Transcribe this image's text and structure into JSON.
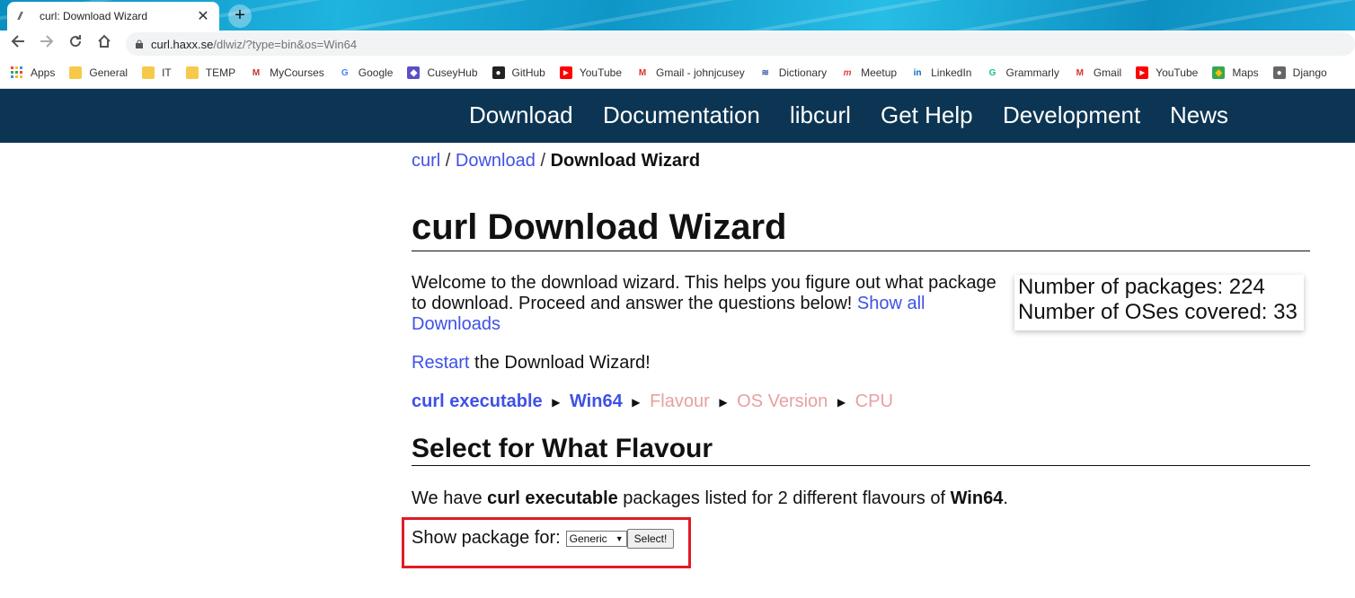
{
  "browser": {
    "tab_title": "curl: Download Wizard",
    "tab_close": "✕",
    "new_tab": "+",
    "url_host": "curl.haxx.se",
    "url_path": "/dlwiz/?type=bin&os=Win64",
    "bookmarks": [
      {
        "label": "Apps",
        "icon": "apps-grid-icon"
      },
      {
        "label": "General",
        "icon": "folder-icon"
      },
      {
        "label": "IT",
        "icon": "folder-icon"
      },
      {
        "label": "TEMP",
        "icon": "folder-icon"
      },
      {
        "label": "MyCourses",
        "icon": "mycourses-icon"
      },
      {
        "label": "Google",
        "icon": "google-icon"
      },
      {
        "label": "CuseyHub",
        "icon": "cuseyhub-icon"
      },
      {
        "label": "GitHub",
        "icon": "github-icon"
      },
      {
        "label": "YouTube",
        "icon": "youtube-icon"
      },
      {
        "label": "Gmail - johnjcusey",
        "icon": "gmail-icon"
      },
      {
        "label": "Dictionary",
        "icon": "dictionary-icon"
      },
      {
        "label": "Meetup",
        "icon": "meetup-icon"
      },
      {
        "label": "LinkedIn",
        "icon": "linkedin-icon"
      },
      {
        "label": "Grammarly",
        "icon": "grammarly-icon"
      },
      {
        "label": "Gmail",
        "icon": "gmail-icon"
      },
      {
        "label": "YouTube",
        "icon": "youtube-icon"
      },
      {
        "label": "Maps",
        "icon": "maps-icon"
      },
      {
        "label": "Django",
        "icon": "globe-icon"
      }
    ]
  },
  "site_nav": [
    "Download",
    "Documentation",
    "libcurl",
    "Get Help",
    "Development",
    "News"
  ],
  "breadcrumb": {
    "home": "curl",
    "sep": "/",
    "parent": "Download",
    "current": "Download Wizard"
  },
  "page_title": "curl Download Wizard",
  "intro": {
    "text": "Welcome to the download wizard. This helps you figure out what package to download. Proceed and answer the questions below!",
    "link": "Show all Downloads"
  },
  "stats": {
    "packages": "Number of packages: 224",
    "oses": "Number of OSes covered: 33"
  },
  "restart": {
    "link": "Restart",
    "text": " the Download Wizard!"
  },
  "steps": {
    "done": [
      "curl executable",
      "Win64"
    ],
    "todo": [
      "Flavour",
      "OS Version",
      "CPU"
    ],
    "arrow": "▶"
  },
  "section_title": "Select for What Flavour",
  "summary": {
    "p1": "We have ",
    "pkg": "curl executable",
    "p2": " packages listed for 2 different flavours of ",
    "os": "Win64",
    "p3": "."
  },
  "form": {
    "label": "Show package for:",
    "selected": "Generic",
    "button": "Select!"
  },
  "colors": {
    "nav_bg": "#0c3553",
    "link": "#3f51e6",
    "todo": "#e8a0a0",
    "highlight": "#e01b24"
  }
}
